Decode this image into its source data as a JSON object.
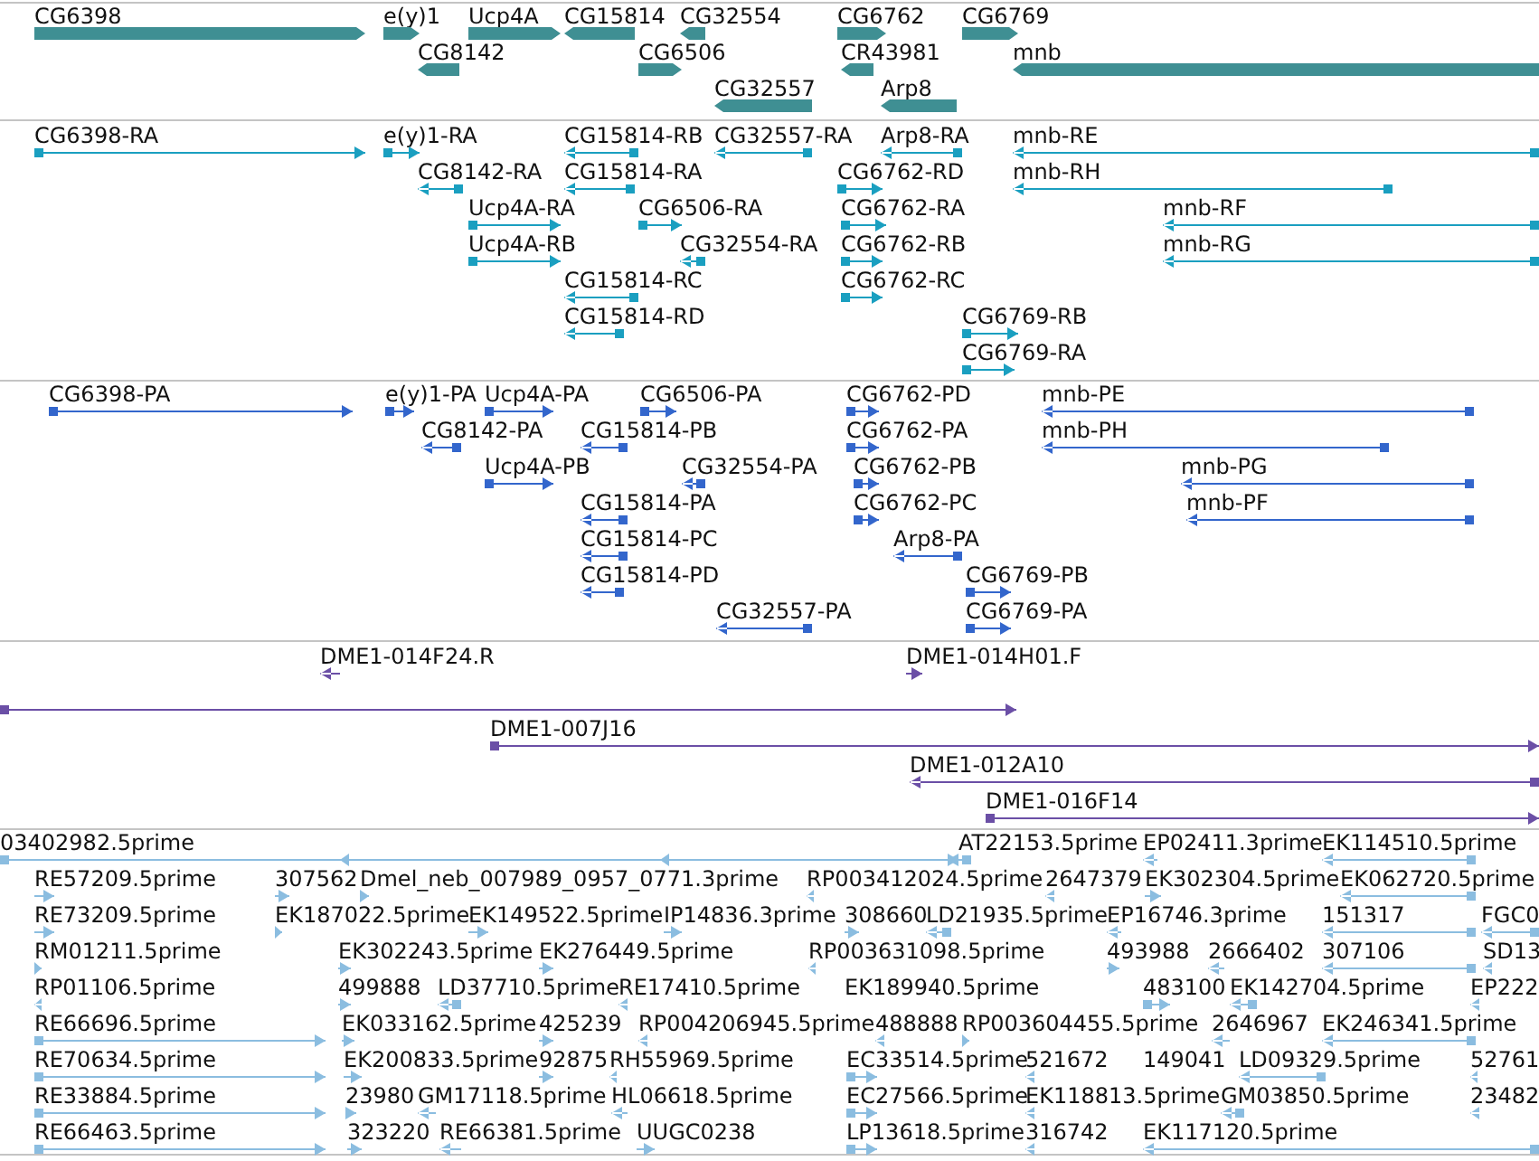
{
  "tracks": [
    {
      "kind": "gene",
      "features": [
        {
          "label": "CG6398",
          "forward": true
        },
        {
          "label": "e(y)1",
          "forward": true
        },
        {
          "label": "Ucp4A",
          "forward": true
        },
        {
          "label": "CG15814",
          "forward": false
        },
        {
          "label": "CG32554",
          "forward": false
        },
        {
          "label": "CG6762",
          "forward": true
        },
        {
          "label": "CG6769",
          "forward": true
        },
        {
          "label": "CG8142",
          "forward": false
        },
        {
          "label": "CG6506",
          "forward": true
        },
        {
          "label": "CR43981",
          "forward": false
        },
        {
          "label": "mnb",
          "forward": false
        },
        {
          "label": "CG32557",
          "forward": false
        },
        {
          "label": "Arp8",
          "forward": false
        }
      ]
    },
    {
      "kind": "transcript",
      "features": [
        {
          "label": "CG6398-RA",
          "forward": true
        },
        {
          "label": "e(y)1-RA",
          "forward": true
        },
        {
          "label": "CG15814-RB",
          "forward": false
        },
        {
          "label": "CG32557-RA",
          "forward": false
        },
        {
          "label": "Arp8-RA",
          "forward": false
        },
        {
          "label": "mnb-RE",
          "forward": false
        },
        {
          "label": "CG8142-RA",
          "forward": false
        },
        {
          "label": "CG15814-RA",
          "forward": false
        },
        {
          "label": "CG6762-RD",
          "forward": true
        },
        {
          "label": "mnb-RH",
          "forward": false
        },
        {
          "label": "Ucp4A-RA",
          "forward": true
        },
        {
          "label": "CG6506-RA",
          "forward": true
        },
        {
          "label": "CG6762-RA",
          "forward": true
        },
        {
          "label": "mnb-RF",
          "forward": false
        },
        {
          "label": "Ucp4A-RB",
          "forward": true
        },
        {
          "label": "CG32554-RA",
          "forward": false
        },
        {
          "label": "CG6762-RB",
          "forward": true
        },
        {
          "label": "mnb-RG",
          "forward": false
        },
        {
          "label": "CG15814-RC",
          "forward": false
        },
        {
          "label": "CG6762-RC",
          "forward": true
        },
        {
          "label": "CG15814-RD",
          "forward": false
        },
        {
          "label": "CG6769-RB",
          "forward": true
        },
        {
          "label": "CG6769-RA",
          "forward": true
        }
      ]
    },
    {
      "kind": "protein",
      "features": [
        {
          "label": "CG6398-PA",
          "forward": true
        },
        {
          "label": "e(y)1-PA",
          "forward": true
        },
        {
          "label": "Ucp4A-PA",
          "forward": true
        },
        {
          "label": "CG6506-PA",
          "forward": true
        },
        {
          "label": "CG6762-PD",
          "forward": true
        },
        {
          "label": "mnb-PE",
          "forward": false
        },
        {
          "label": "CG8142-PA",
          "forward": false
        },
        {
          "label": "CG15814-PB",
          "forward": false
        },
        {
          "label": "CG6762-PA",
          "forward": true
        },
        {
          "label": "mnb-PH",
          "forward": false
        },
        {
          "label": "Ucp4A-PB",
          "forward": true
        },
        {
          "label": "CG32554-PA",
          "forward": false
        },
        {
          "label": "CG6762-PB",
          "forward": true
        },
        {
          "label": "mnb-PG",
          "forward": false
        },
        {
          "label": "CG15814-PA",
          "forward": false
        },
        {
          "label": "CG6762-PC",
          "forward": true
        },
        {
          "label": "mnb-PF",
          "forward": false
        },
        {
          "label": "CG15814-PC",
          "forward": false
        },
        {
          "label": "Arp8-PA",
          "forward": false
        },
        {
          "label": "CG15814-PD",
          "forward": false
        },
        {
          "label": "CG6769-PB",
          "forward": true
        },
        {
          "label": "CG32557-PA",
          "forward": false
        },
        {
          "label": "CG6769-PA",
          "forward": true
        }
      ]
    },
    {
      "kind": "clone",
      "features": [
        {
          "label": "DME1-014F24.R",
          "forward": false
        },
        {
          "label": "DME1-014H01.F",
          "forward": true
        },
        {
          "forward": true
        },
        {
          "label": "DME1-007J16",
          "forward": true
        },
        {
          "label": "DME1-012A10",
          "forward": false
        },
        {
          "label": "DME1-016F14",
          "forward": true
        }
      ]
    },
    {
      "kind": "est",
      "features": [
        {
          "label": "03402982.5prime",
          "forward": true
        },
        {
          "forward": false
        },
        {
          "forward": false
        },
        {
          "label": "AT22153.5prime",
          "forward": false
        },
        {
          "label": "EP02411.3prime",
          "forward": false
        },
        {
          "label": "EK114510.5prime",
          "forward": false
        },
        {
          "label": "RE57209.5prime",
          "forward": true
        },
        {
          "label": "307562",
          "forward": true
        },
        {
          "label": "Dmel_neb_007989_0957_0771.3prime",
          "forward": true
        },
        {
          "label": "RP003412024.5prime",
          "forward": false
        },
        {
          "label": "2647379",
          "forward": false
        },
        {
          "label": "EK302304.5prime",
          "forward": true
        },
        {
          "label": "EK062720.5prime",
          "forward": false
        },
        {
          "label": "RE73209.5prime",
          "forward": true
        },
        {
          "label": "EK187022.5prime",
          "forward": true
        },
        {
          "label": "EK149522.5prime",
          "forward": true
        },
        {
          "label": "IP14836.3prime",
          "forward": true
        },
        {
          "label": "308660",
          "forward": true
        },
        {
          "label": "LD21935.5prime",
          "forward": false
        },
        {
          "label": "EP16746.3prime",
          "forward": false
        },
        {
          "label": "151317",
          "forward": false
        },
        {
          "label": "FGC0",
          "forward": false
        },
        {
          "label": "RM01211.5prime",
          "forward": true
        },
        {
          "label": "EK302243.5prime",
          "forward": true
        },
        {
          "label": "EK276449.5prime",
          "forward": true
        },
        {
          "label": "RP003631098.5prime",
          "forward": false
        },
        {
          "label": "493988",
          "forward": true
        },
        {
          "label": "2666402",
          "forward": false
        },
        {
          "label": "307106",
          "forward": false
        },
        {
          "label": "SD13",
          "forward": false
        },
        {
          "label": "RP01106.5prime",
          "forward": false
        },
        {
          "label": "499888",
          "forward": true
        },
        {
          "label": "LD37710.5prime",
          "forward": false
        },
        {
          "label": "RE17410.5prime",
          "forward": false
        },
        {
          "label": "EK189940.5prime"
        },
        {
          "label": "483100",
          "forward": true
        },
        {
          "label": "EK142704.5prime",
          "forward": false
        },
        {
          "label": "EP222",
          "forward": false
        },
        {
          "label": "RE66696.5prime",
          "forward": true
        },
        {
          "label": "EK033162.5prime",
          "forward": true
        },
        {
          "label": "425239",
          "forward": true
        },
        {
          "label": "RP004206945.5prime",
          "forward": false
        },
        {
          "label": "488888",
          "forward": false
        },
        {
          "label": "RP003604455.5prime",
          "forward": true
        },
        {
          "label": "2646967",
          "forward": false
        },
        {
          "label": "EK246341.5prime",
          "forward": false
        },
        {
          "label": "RE70634.5prime",
          "forward": true
        },
        {
          "label": "EK200833.5prime",
          "forward": true
        },
        {
          "label": "92875",
          "forward": true
        },
        {
          "label": "RH55969.5prime",
          "forward": false
        },
        {
          "label": "EC33514.5prime",
          "forward": true
        },
        {
          "label": "521672",
          "forward": false
        },
        {
          "label": "149041"
        },
        {
          "label": "LD09329.5prime",
          "forward": false
        },
        {
          "label": "52761",
          "forward": false
        },
        {
          "label": "RE33884.5prime",
          "forward": true
        },
        {
          "label": "23980",
          "forward": true
        },
        {
          "label": "GM17118.5prime",
          "forward": false
        },
        {
          "label": "HL06618.5prime",
          "forward": false
        },
        {
          "label": "EC27566.5prime",
          "forward": true
        },
        {
          "label": "EK118813.5prime",
          "forward": false
        },
        {
          "label": "GM03850.5prime",
          "forward": false
        },
        {
          "label": "23482",
          "forward": false
        },
        {
          "label": "RE66463.5prime",
          "forward": true
        },
        {
          "label": "323220",
          "forward": true
        },
        {
          "label": "RE66381.5prime",
          "forward": false
        },
        {
          "label": "UUGC0238",
          "forward": true
        },
        {
          "label": "LP13618.5prime",
          "forward": true
        },
        {
          "label": "316742",
          "forward": false
        },
        {
          "label": "EK117120.5prime",
          "forward": false
        }
      ]
    }
  ]
}
